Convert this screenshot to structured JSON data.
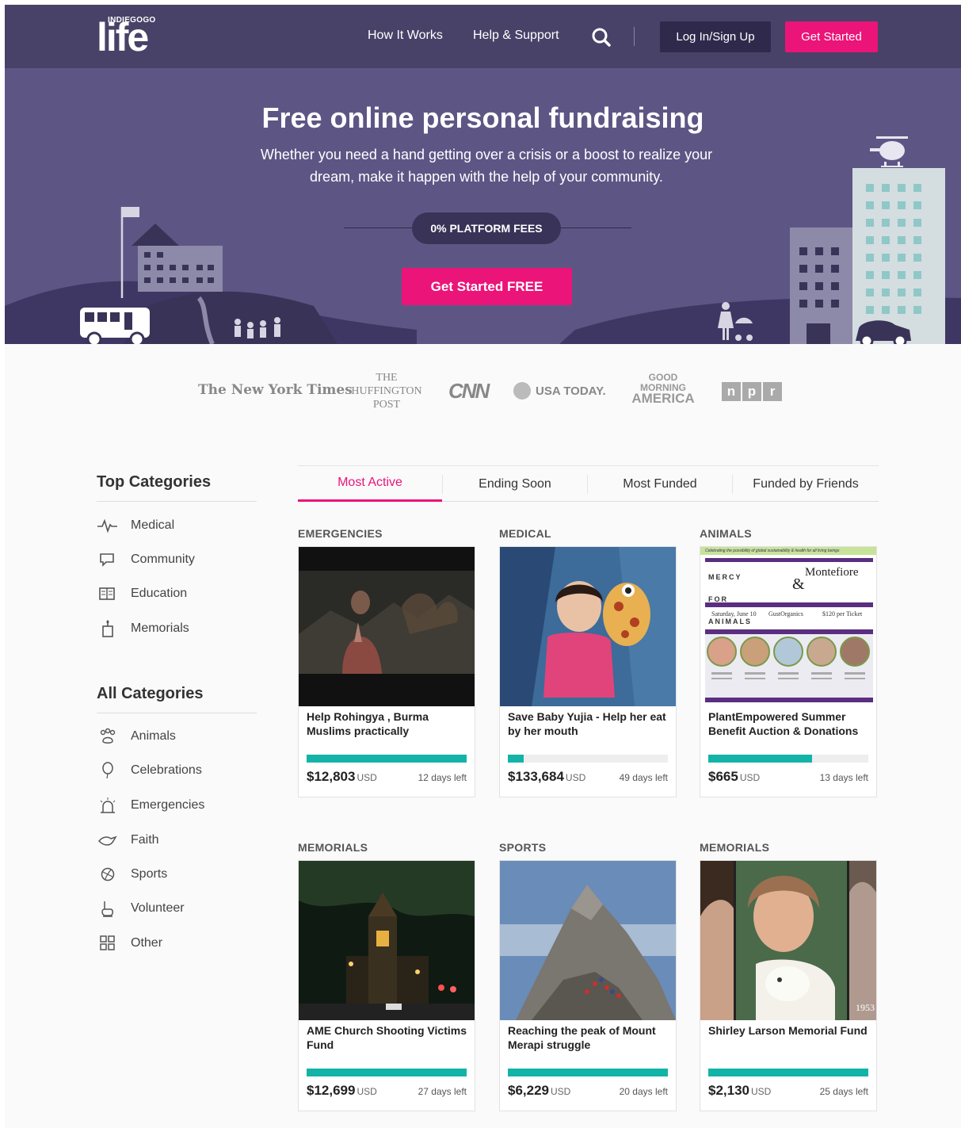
{
  "nav": {
    "brand_small": "INDIEGOGO",
    "brand_logo": "life",
    "links": [
      "How It Works",
      "Help & Support"
    ],
    "search_icon": "search-icon",
    "login_label": "Log In/Sign Up",
    "cta_label": "Get Started"
  },
  "hero": {
    "title": "Free online personal fundraising",
    "subtitle": "Whether you need a hand getting over a crisis or a boost to realize your dream, make it happen with the help of your community.",
    "fees_badge": "0% PLATFORM FEES",
    "cta_label": "Get Started FREE"
  },
  "press": {
    "nyt": "The New York Times",
    "huffpost_1": "THE",
    "huffpost_2": "HUFFINGTON",
    "huffpost_3": "POST",
    "cnn": "CNN",
    "usatoday": "USA TODAY.",
    "gma_1": "GOOD",
    "gma_2": "MORNING",
    "gma_3": "AMERICA",
    "npr": [
      "n",
      "p",
      "r"
    ]
  },
  "sidebar": {
    "top_heading": "Top Categories",
    "top_items": [
      {
        "label": "Medical",
        "icon": "heartbeat-icon"
      },
      {
        "label": "Community",
        "icon": "chat-bubble-icon"
      },
      {
        "label": "Education",
        "icon": "book-icon"
      },
      {
        "label": "Memorials",
        "icon": "candle-icon"
      }
    ],
    "all_heading": "All Categories",
    "all_items": [
      {
        "label": "Animals",
        "icon": "paw-icon"
      },
      {
        "label": "Celebrations",
        "icon": "balloon-icon"
      },
      {
        "label": "Emergencies",
        "icon": "siren-icon"
      },
      {
        "label": "Faith",
        "icon": "dove-icon"
      },
      {
        "label": "Sports",
        "icon": "ball-icon"
      },
      {
        "label": "Volunteer",
        "icon": "helping-hand-icon"
      },
      {
        "label": "Other",
        "icon": "grid-icon"
      }
    ]
  },
  "tabs": [
    "Most Active",
    "Ending Soon",
    "Most Funded",
    "Funded by Friends"
  ],
  "active_tab": "Most Active",
  "campaigns": [
    {
      "category": "EMERGENCIES",
      "title": "Help Rohingya , Burma Muslims practically",
      "amount": "$12,803",
      "currency": "USD",
      "days_left": "12 days left",
      "progress": 1.0
    },
    {
      "category": "MEDICAL",
      "title": "Save Baby Yujia - Help her eat by her mouth",
      "amount": "$133,684",
      "currency": "USD",
      "days_left": "49 days left",
      "progress": 0.1
    },
    {
      "category": "ANIMALS",
      "title": "PlantEmpowered Summer Benefit Auction & Donations",
      "amount": "$665",
      "currency": "USD",
      "days_left": "13 days left",
      "progress": 0.65
    },
    {
      "category": "MEMORIALS",
      "title": "AME Church Shooting Victims Fund",
      "amount": "$12,699",
      "currency": "USD",
      "days_left": "27 days left",
      "progress": 1.0
    },
    {
      "category": "SPORTS",
      "title": "Reaching the peak of Mount Merapi struggle",
      "amount": "$6,229",
      "currency": "USD",
      "days_left": "20 days left",
      "progress": 1.0
    },
    {
      "category": "MEMORIALS",
      "title": "Shirley Larson Memorial Fund",
      "amount": "$2,130",
      "currency": "USD",
      "days_left": "25 days left",
      "progress": 1.0
    }
  ],
  "flyer": {
    "banner": "Celebrating the possibility of global sustainability & health for all living beings",
    "org": "MERCY FOR ANIMALS",
    "amp": "&",
    "hospital": "Montefiore",
    "date": "Saturday, June 10",
    "venue": "GustOrganics",
    "price": "$120 per Ticket"
  },
  "photo_year": "1953",
  "colors": {
    "nav_bg": "#484268",
    "hero_bg": "#5d5685",
    "accent": "#eb1478",
    "progress": "#14b3a8"
  }
}
